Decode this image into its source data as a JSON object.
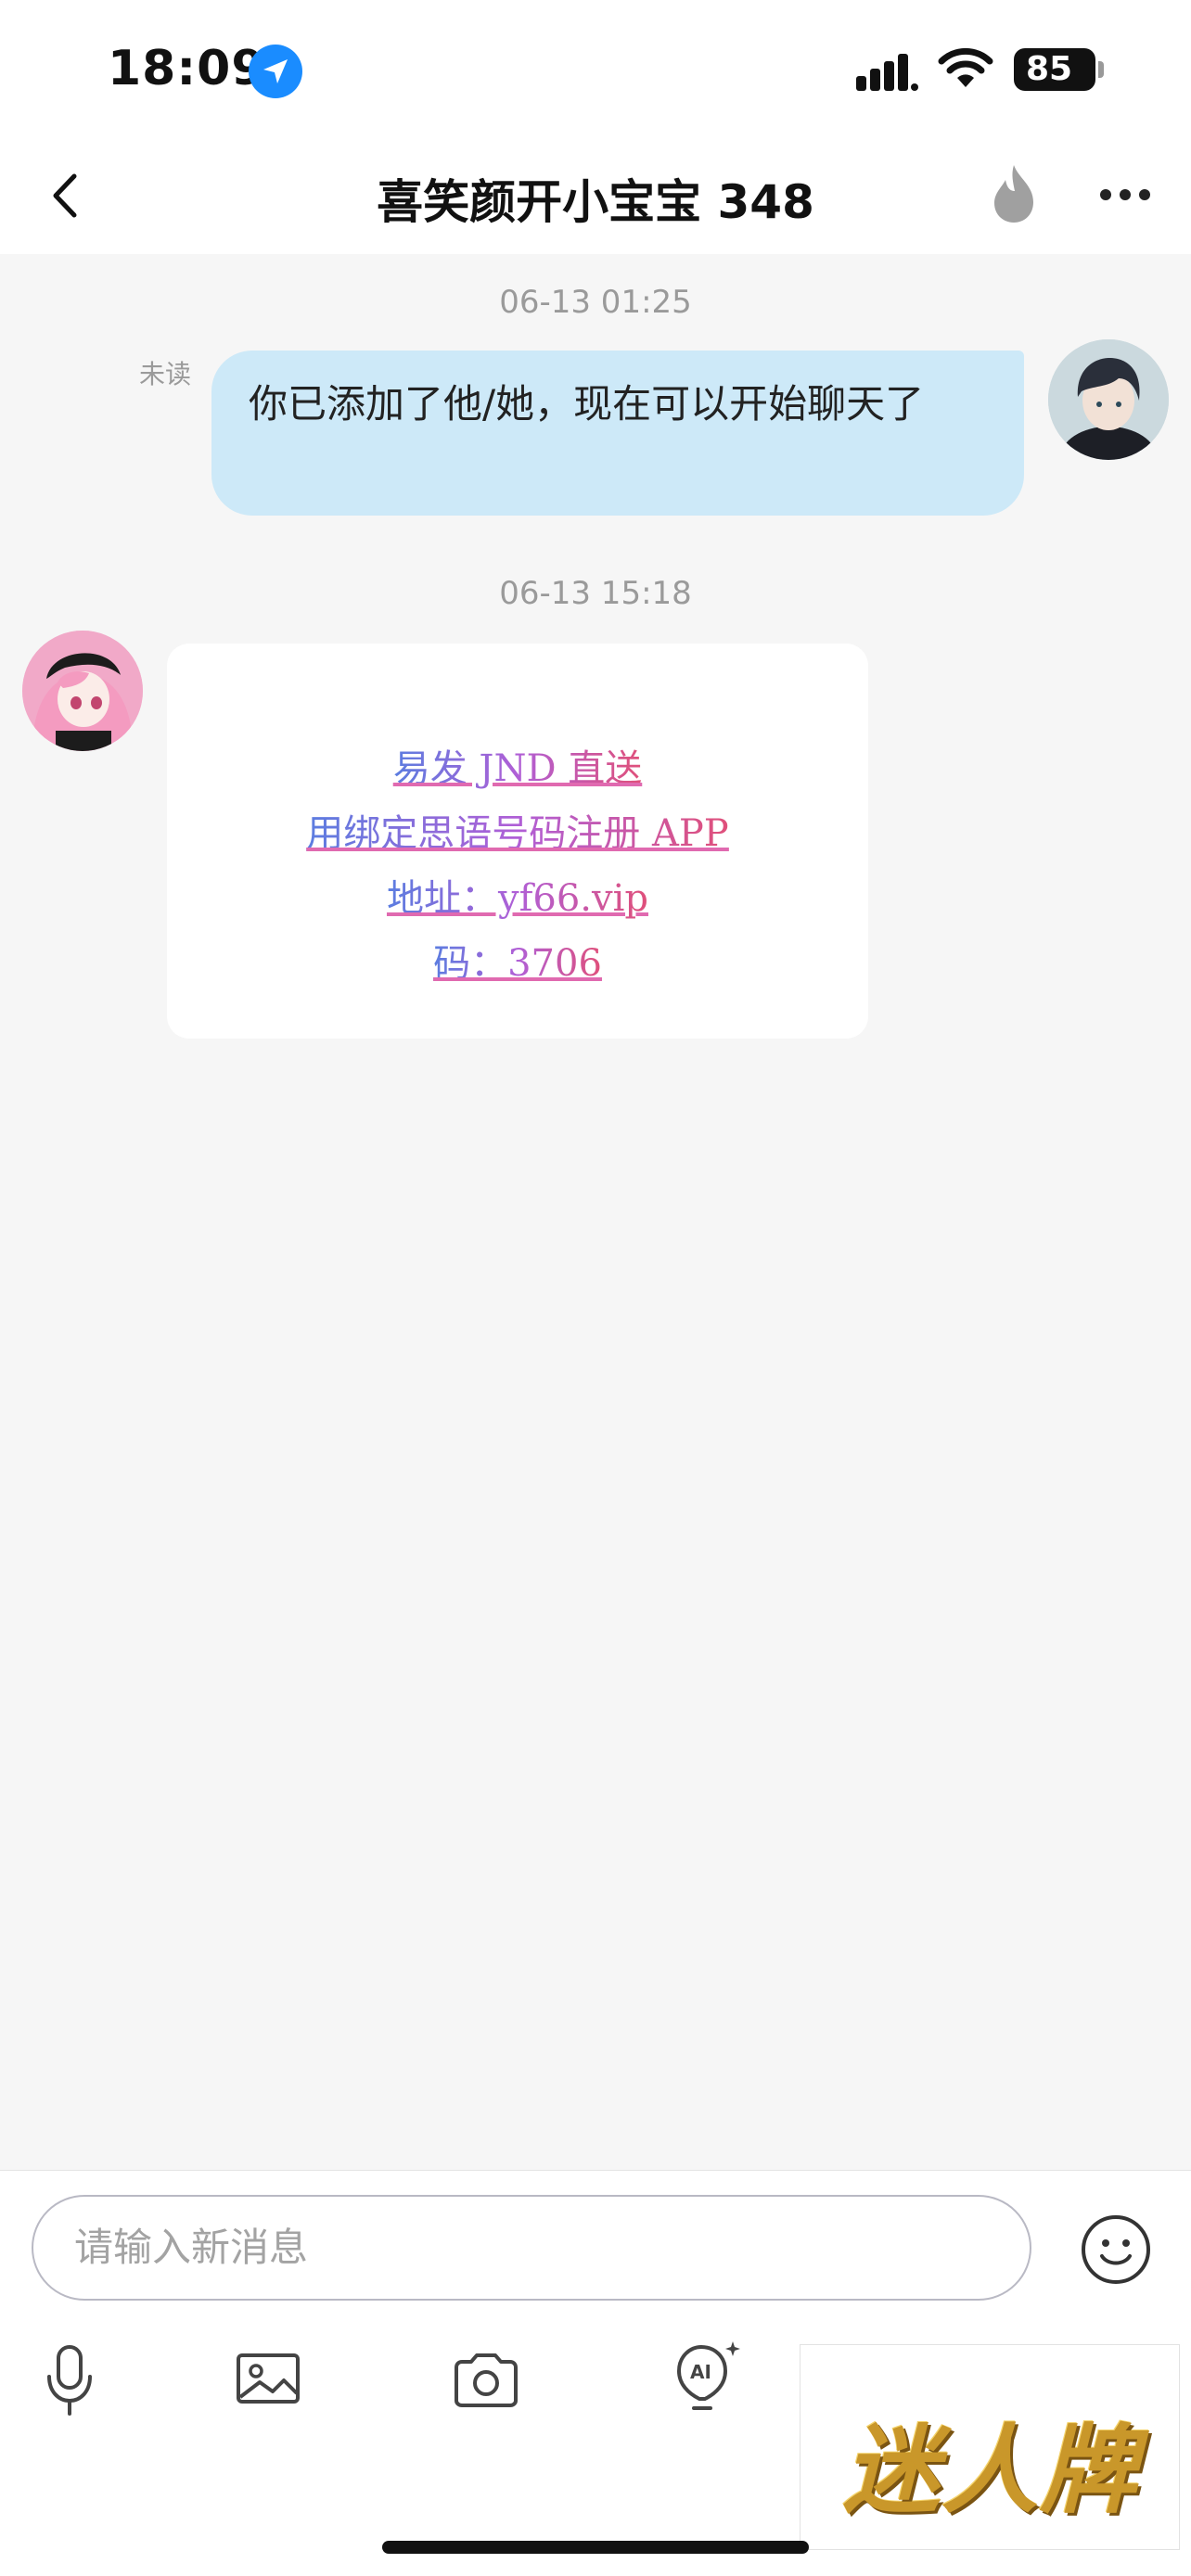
{
  "status_bar": {
    "time": "18:09",
    "battery": "85",
    "icons": [
      "location-arrow-icon",
      "cellular-signal-icon",
      "wifi-icon",
      "battery-icon"
    ]
  },
  "header": {
    "title": "喜笑颜开小宝宝 348",
    "icons": [
      "back-chevron-icon",
      "flame-icon",
      "more-dots-icon"
    ]
  },
  "messages": [
    {
      "timestamp": "06-13 01:25",
      "side": "right",
      "status": "未读",
      "text": "你已添加了他/她，现在可以开始聊天了"
    },
    {
      "timestamp": "06-13 15:18",
      "side": "left",
      "lines": [
        "易发 JND 直送",
        "用绑定思语号码注册 APP",
        "地址：yf66.vip",
        "码：3706"
      ]
    }
  ],
  "input": {
    "placeholder": "请输入新消息"
  },
  "toolbar": {
    "icons": [
      "microphone-icon",
      "image-icon",
      "camera-icon",
      "ai-lightbulb-icon",
      "emoji-icon"
    ]
  },
  "watermark": {
    "text": "迷人牌"
  },
  "colors": {
    "bubble_right": "#cde9f8",
    "background": "#f6f6f6",
    "accent_blue": "#1a8cff"
  }
}
